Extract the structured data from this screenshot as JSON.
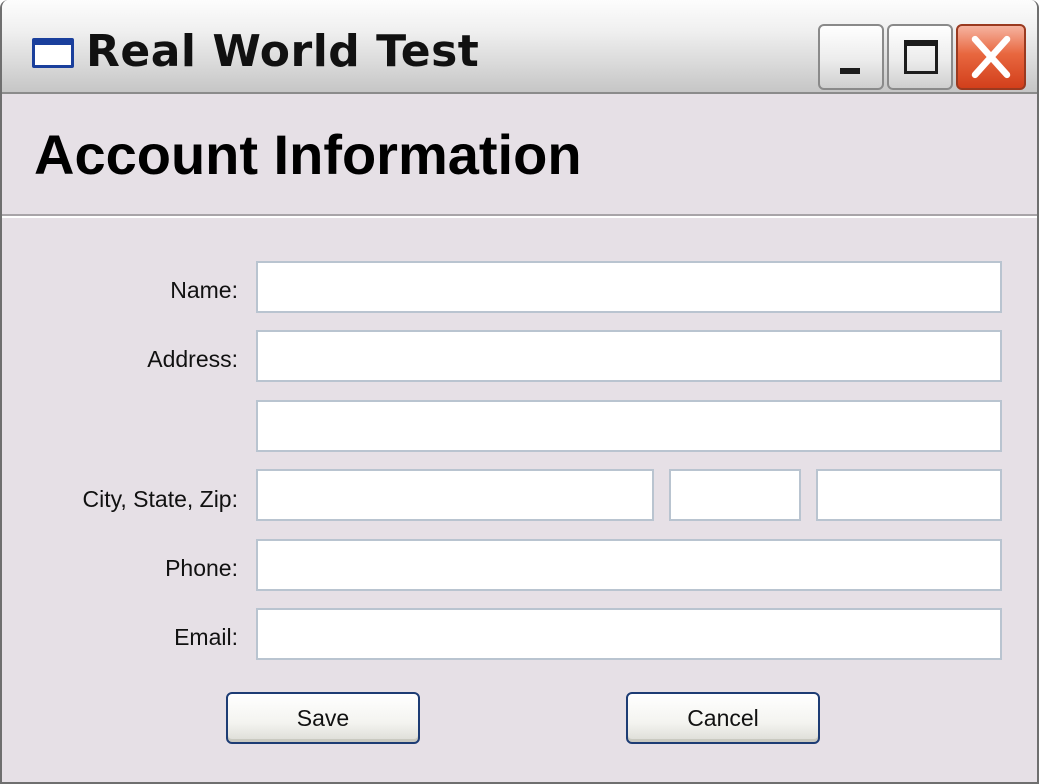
{
  "window": {
    "title": "Real World Test"
  },
  "header": {
    "title": "Account Information"
  },
  "form": {
    "name_label": "Name:",
    "address_label": "Address:",
    "city_state_zip_label": "City, State, Zip:",
    "phone_label": "Phone:",
    "email_label": "Email:",
    "name_value": "",
    "address1_value": "",
    "address2_value": "",
    "city_value": "",
    "state_value": "",
    "zip_value": "",
    "phone_value": "",
    "email_value": ""
  },
  "buttons": {
    "save_label": "Save",
    "cancel_label": "Cancel"
  },
  "icons": {
    "window_icon": "window-icon",
    "minimize": "minimize-icon",
    "maximize": "maximize-icon",
    "close": "close-icon"
  },
  "colors": {
    "window_bg": "#e6e0e6",
    "close_button": "#e8673f",
    "button_border": "#1d3c74"
  }
}
